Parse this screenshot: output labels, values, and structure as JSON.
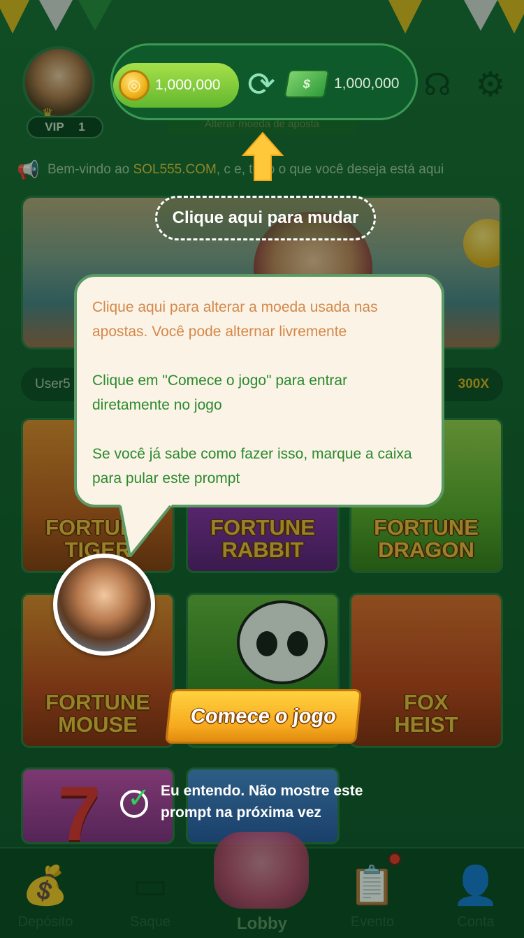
{
  "header": {
    "vip_label": "VIP",
    "vip_level": "1",
    "coin_balance": "1,000,000",
    "cash_balance": "1,000,000",
    "change_currency_label": "Alterar moeda de aposta"
  },
  "announcement": {
    "prefix": "Bem-vindo ao ",
    "site": "SOL555.COM",
    "suffix": ", c  e, tudo o que você deseja está aqui"
  },
  "winners": {
    "user": "User5",
    "multiplier": "300X"
  },
  "games": [
    {
      "title": "FORTUNE\nTIGER"
    },
    {
      "title": "FORTUNE\nRABBIT"
    },
    {
      "title": "FORTUNE\nDRAGON"
    },
    {
      "title": "FORTUNE\nMOUSE"
    },
    {
      "title": ""
    },
    {
      "title": "FOX\nHEIST"
    }
  ],
  "guide": {
    "click_here": "Clique aqui para mudar",
    "line1": "Clique aqui para alterar a moeda usada nas apostas. Você pode alternar livremente",
    "line2": "Clique em \"Comece o jogo\" para entrar diretamente no jogo",
    "line3": "Se você já sabe como fazer isso, marque a caixa para pular este prompt",
    "start_button": "Comece o jogo",
    "skip_checkbox_label": "Eu entendo. Não mostre este prompt na próxima vez",
    "skip_checked": true
  },
  "nav": {
    "items": [
      {
        "label": "Depósito",
        "icon": "money-bag-icon"
      },
      {
        "label": "Saque",
        "icon": "wallet-icon"
      },
      {
        "label": "Lobby",
        "icon": "gamepad-icon",
        "active": true
      },
      {
        "label": "Evento",
        "icon": "clipboard-check-icon"
      },
      {
        "label": "Conta",
        "icon": "sombrero-user-icon"
      }
    ]
  },
  "colors": {
    "background": "#176230",
    "accent_gold": "#f5d326",
    "bubble_border": "#5b9a64",
    "bubble_orange_text": "#d4884a",
    "bubble_green_text": "#2a8a2e"
  }
}
